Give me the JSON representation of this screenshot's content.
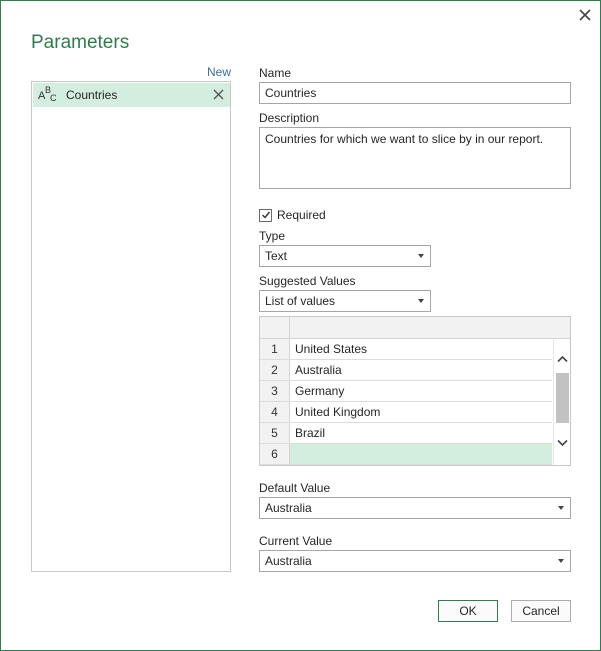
{
  "dialog": {
    "title": "Parameters",
    "close_icon": "close-icon"
  },
  "parameters": {
    "new_label": "New",
    "items": [
      {
        "icon": "abc-text-type-icon",
        "icon_a": "A",
        "icon_b": "B",
        "icon_c": "C",
        "label": "Countries",
        "remove_icon": "remove-x-icon"
      }
    ]
  },
  "form": {
    "name_label": "Name",
    "name_value": "Countries",
    "description_label": "Description",
    "description_value": "Countries for which we want to slice by in our report.",
    "required_label": "Required",
    "required_checked": true,
    "type_label": "Type",
    "type_value": "Text",
    "suggested_label": "Suggested Values",
    "suggested_value": "List of values",
    "values_list": [
      {
        "num": "1",
        "value": "United States"
      },
      {
        "num": "2",
        "value": "Australia"
      },
      {
        "num": "3",
        "value": "Germany"
      },
      {
        "num": "4",
        "value": "United Kingdom"
      },
      {
        "num": "5",
        "value": "Brazil"
      },
      {
        "num": "6",
        "value": ""
      }
    ],
    "default_label": "Default Value",
    "default_value": "Australia",
    "current_label": "Current Value",
    "current_value": "Australia"
  },
  "buttons": {
    "ok": "OK",
    "cancel": "Cancel"
  },
  "colors": {
    "accent": "#2e7d4f",
    "selection": "#d3eddf",
    "link": "#3a6ea5"
  }
}
